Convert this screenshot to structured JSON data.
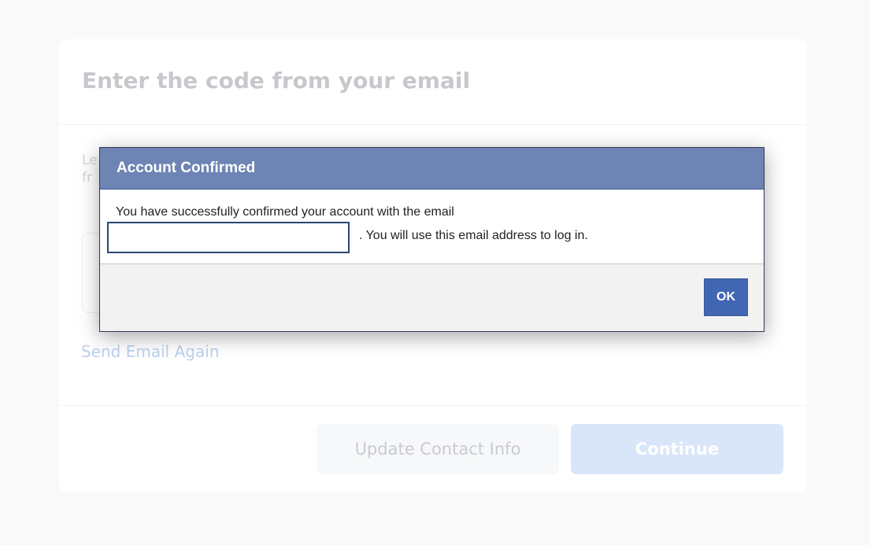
{
  "card": {
    "title": "Enter the code from your email",
    "body_text_line1": "Le",
    "body_text_line2": "fr",
    "send_again_label": "Send Email Again",
    "update_contact_label": "Update Contact Info",
    "continue_label": "Continue"
  },
  "dialog": {
    "title": "Account Confirmed",
    "message_line1": "You have successfully confirmed your account with the email",
    "message_line2": ". You will use this email address to log in.",
    "email_value": "",
    "ok_label": "OK"
  },
  "colors": {
    "dialog_header": "#6d84b4",
    "ok_button": "#4267b2",
    "continue_button": "#d9e6fa"
  }
}
